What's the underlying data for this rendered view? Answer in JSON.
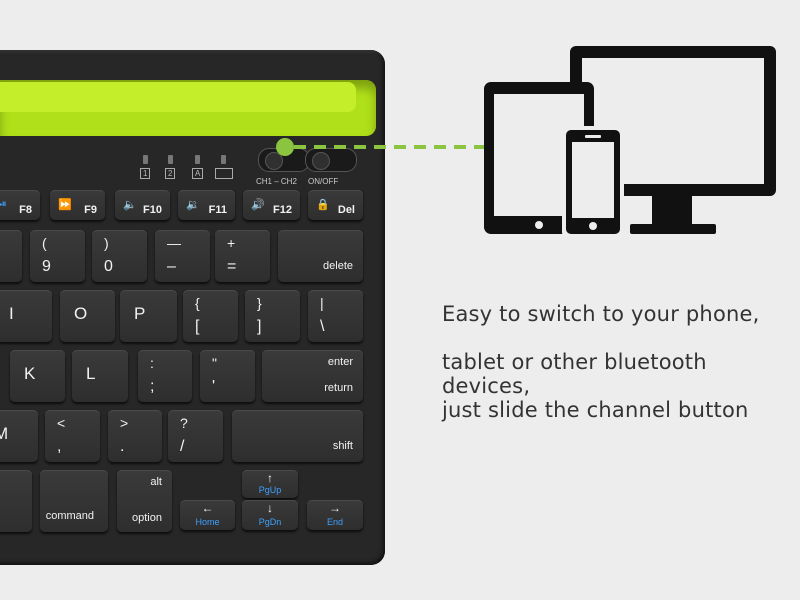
{
  "colors": {
    "accent": "#8bc43f",
    "keyboard": "#272727",
    "slot": "#b0e01a",
    "blue_labels": "#3ea0ff"
  },
  "indicators": [
    "1",
    "2",
    "A",
    "battery"
  ],
  "switches": {
    "channel": "CH1 – CH2",
    "power": "ON/OFF"
  },
  "keys": [
    {
      "top": "⏯",
      "main": "F8"
    },
    {
      "top": "⏩",
      "main": "F9"
    },
    {
      "top": "🔈",
      "main": "F10"
    },
    {
      "top": "🔉",
      "main": "F11"
    },
    {
      "top": "🔊",
      "main": "F12"
    },
    {
      "top": "🔒",
      "main": "Del"
    },
    {
      "top": "",
      "main": ""
    },
    {
      "top": "(",
      "main": "9"
    },
    {
      "top": ")",
      "main": "0"
    },
    {
      "top": "—",
      "main": "–"
    },
    {
      "top": "+",
      "main": "="
    },
    {
      "top": "",
      "main": "delete"
    },
    {
      "top": "",
      "main": "I"
    },
    {
      "top": "",
      "main": "O"
    },
    {
      "top": "",
      "main": "P"
    },
    {
      "top": "{",
      "main": "["
    },
    {
      "top": "}",
      "main": "]"
    },
    {
      "top": "|",
      "main": "\\"
    },
    {
      "top": "",
      "main": "K"
    },
    {
      "top": "",
      "main": "L"
    },
    {
      "top": ":",
      "main": ";"
    },
    {
      "top": "\"",
      "main": "'"
    },
    {
      "top": "enter",
      "main": "return"
    },
    {
      "top": "",
      "main": "M"
    },
    {
      "top": "<",
      "main": ","
    },
    {
      "top": ">",
      "main": "."
    },
    {
      "top": "?",
      "main": "/"
    },
    {
      "top": "",
      "main": "shift"
    },
    {
      "top": "",
      "main": ""
    },
    {
      "top": "",
      "main": "command"
    },
    {
      "top": "alt",
      "main": "option"
    },
    {
      "top": "←",
      "main": "Home"
    },
    {
      "top": "↑",
      "main": "PgUp"
    },
    {
      "top": "↓",
      "main": "PgDn"
    },
    {
      "top": "→",
      "main": "End"
    }
  ],
  "icons": [
    "tablet-icon",
    "monitor-icon",
    "phone-icon"
  ],
  "description": [
    "Easy to switch to your phone,",
    "tablet or other bluetooth devices,",
    "just slide the channel button"
  ]
}
